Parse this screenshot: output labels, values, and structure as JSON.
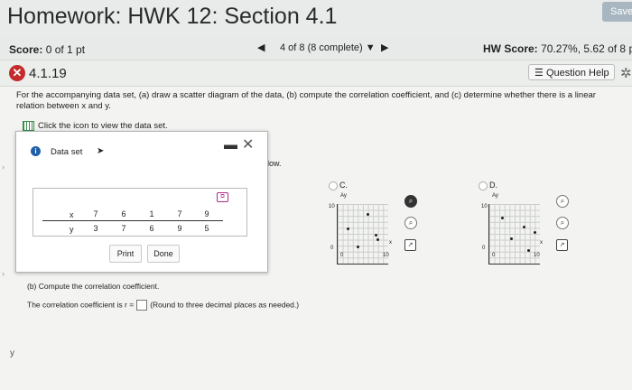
{
  "header": {
    "title": "Homework: HWK 12: Section 4.1",
    "save_label": "Save"
  },
  "scorebar": {
    "score_label": "Score:",
    "score_value": "0 of 1 pt",
    "nav_label": "4 of 8 (8 complete)",
    "hw_score_label": "HW Score:",
    "hw_score_value": "70.27%, 5.62 of 8 p"
  },
  "question": {
    "number": "4.1.19",
    "help_label": "Question Help",
    "instructions": "For the accompanying data set, (a) draw a scatter diagram of the data, (b) compute the correlation coefficient, and (c) determine whether there is a linear relation between x and y.",
    "click_text": "Click the icon to view the data set."
  },
  "dialog": {
    "title": "Data set",
    "x_label": "x",
    "y_label": "y",
    "x_values": [
      "7",
      "6",
      "1",
      "7",
      "9"
    ],
    "y_values": [
      "3",
      "7",
      "6",
      "9",
      "5"
    ],
    "print_label": "Print",
    "done_label": "Done"
  },
  "behind": {
    "below_text": "low.",
    "option_c": "C.",
    "option_d": "D.",
    "axis_y": "Ay",
    "axis_x": "x",
    "tick_10": "10",
    "tick_0": "0"
  },
  "part_b": {
    "heading": "(b) Compute the correlation coefficient.",
    "prompt": "The correlation coefficient is r =",
    "note": "(Round to three decimal places as needed.)"
  },
  "colors": {
    "error_badge": "#c42b2b",
    "info_icon": "#1f5fa8"
  }
}
